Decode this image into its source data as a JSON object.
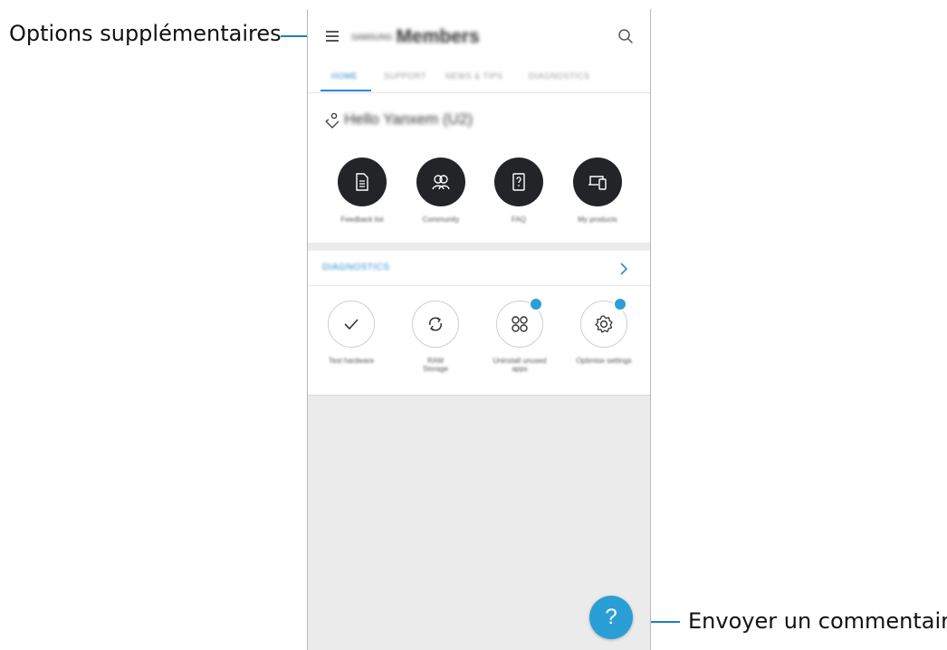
{
  "callouts": {
    "menu": "Options supplémentaires",
    "fab": "Envoyer un commentaire"
  },
  "app": {
    "brand_prefix": "SAMSUNG",
    "title": "Members",
    "tabs": [
      "HOME",
      "SUPPORT",
      "NEWS & TIPS",
      "DIAGNOSTICS"
    ],
    "active_tab": "HOME"
  },
  "greeting": "Hello Yanxem (U2)",
  "quick_actions": [
    {
      "label": "Feedback list",
      "icon": "document-icon"
    },
    {
      "label": "Community",
      "icon": "community-icon"
    },
    {
      "label": "FAQ",
      "icon": "faq-icon"
    },
    {
      "label": "My products",
      "icon": "devices-icon"
    }
  ],
  "diagnostics": {
    "title": "DIAGNOSTICS",
    "items": [
      {
        "label_line1": "Test hardware",
        "label_line2": "",
        "icon": "check-icon",
        "badge": false
      },
      {
        "label_line1": "RAM",
        "label_line2": "Storage",
        "icon": "refresh-icon",
        "badge": false
      },
      {
        "label_line1": "Uninstall unused",
        "label_line2": "apps",
        "icon": "apps-icon",
        "badge": true
      },
      {
        "label_line1": "Optimise settings",
        "label_line2": "",
        "icon": "settings-icon",
        "badge": true
      }
    ]
  },
  "fab": {
    "symbol": "?"
  },
  "colors": {
    "accent": "#2a8ad0",
    "fab": "#2a9fd6",
    "dark_button": "#222428"
  }
}
